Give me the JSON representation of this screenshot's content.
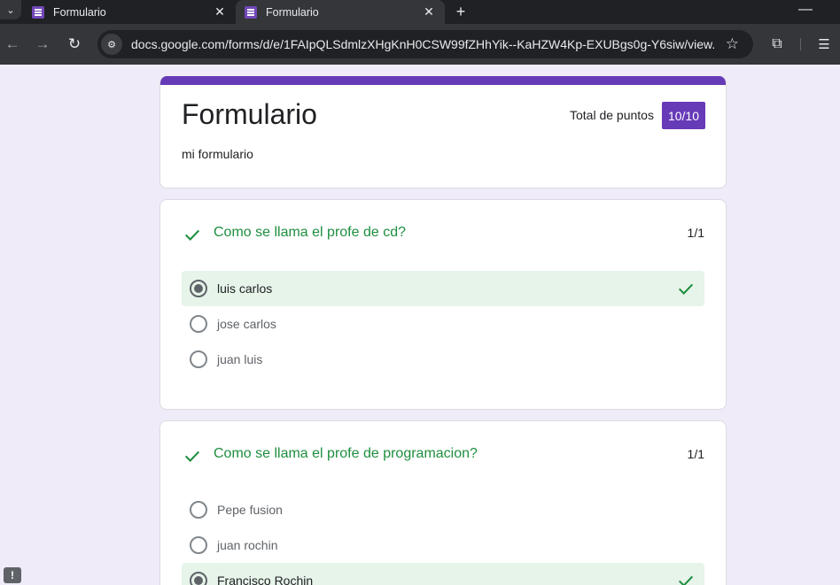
{
  "browser": {
    "tabs": [
      {
        "title": "Formulario",
        "favicon": "google-forms-icon",
        "active": false
      },
      {
        "title": "Formulario",
        "favicon": "google-forms-icon",
        "active": true
      }
    ],
    "url": "docs.google.com/forms/d/e/1FAIpQLSdmlzXHgKnH0CSW99fZHhYik--KaHZW4Kp-EXUBgs0g-Y6siw/view..."
  },
  "form": {
    "title": "Formulario",
    "description": "mi formulario",
    "points_label": "Total de puntos",
    "points_value": "10/10",
    "accent_color": "#673ab7"
  },
  "questions": [
    {
      "title": "Como se llama el profe de cd?",
      "score": "1/1",
      "options": [
        {
          "label": "luis carlos",
          "selected": true,
          "correct": true
        },
        {
          "label": "jose carlos",
          "selected": false,
          "correct": false
        },
        {
          "label": "juan luis",
          "selected": false,
          "correct": false
        }
      ]
    },
    {
      "title": "Como se llama el profe de programacion?",
      "score": "1/1",
      "options": [
        {
          "label": "Pepe fusion",
          "selected": false,
          "correct": false
        },
        {
          "label": "juan rochin",
          "selected": false,
          "correct": false
        },
        {
          "label": "Francisco Rochin",
          "selected": true,
          "correct": true
        }
      ]
    }
  ],
  "colors": {
    "correct_green": "#1e8e3e",
    "correct_bg": "#e6f4ea",
    "page_bg": "#f0ebf8"
  },
  "feedback_label": "!"
}
